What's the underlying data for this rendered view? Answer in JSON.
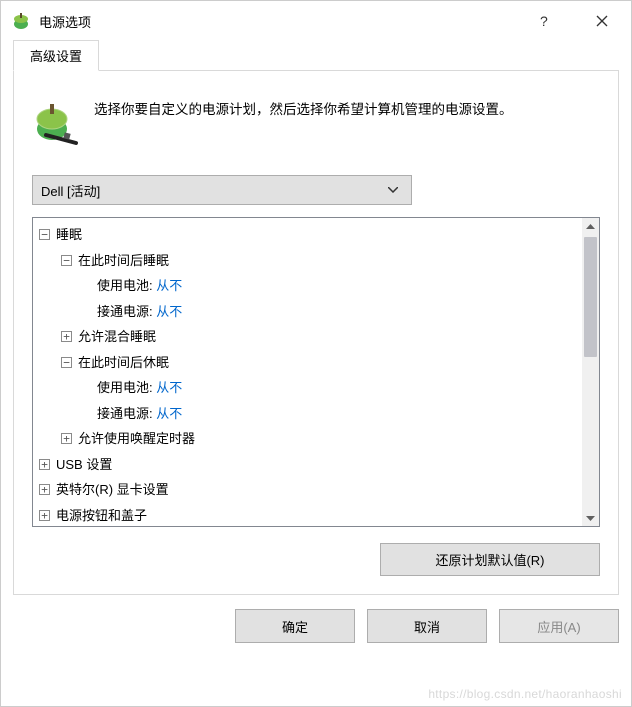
{
  "titlebar": {
    "title": "电源选项"
  },
  "tabs": {
    "advanced": "高级设置"
  },
  "description": "选择你要自定义的电源计划，然后选择你希望计算机管理的电源设置。",
  "plan_combo": {
    "selected": "Dell [活动]"
  },
  "tree": {
    "sleep": {
      "label": "睡眠",
      "sleep_after": {
        "label": "在此时间后睡眠",
        "battery": {
          "label": "使用电池:",
          "value": "从不"
        },
        "plugged": {
          "label": "接通电源:",
          "value": "从不"
        }
      },
      "hybrid_sleep": {
        "label": "允许混合睡眠"
      },
      "hibernate_after": {
        "label": "在此时间后休眠",
        "battery": {
          "label": "使用电池:",
          "value": "从不"
        },
        "plugged": {
          "label": "接通电源:",
          "value": "从不"
        }
      },
      "wake_timers": {
        "label": "允许使用唤醒定时器"
      }
    },
    "usb": {
      "label": "USB 设置"
    },
    "intel_graphics": {
      "label": "英特尔(R) 显卡设置"
    },
    "power_buttons": {
      "label": "电源按钮和盖子"
    }
  },
  "buttons": {
    "restore_defaults": "还原计划默认值(R)",
    "ok": "确定",
    "cancel": "取消",
    "apply": "应用(A)"
  },
  "glyphs": {
    "plus": "+",
    "minus": "−"
  },
  "watermark": "https://blog.csdn.net/haoranhaoshi"
}
